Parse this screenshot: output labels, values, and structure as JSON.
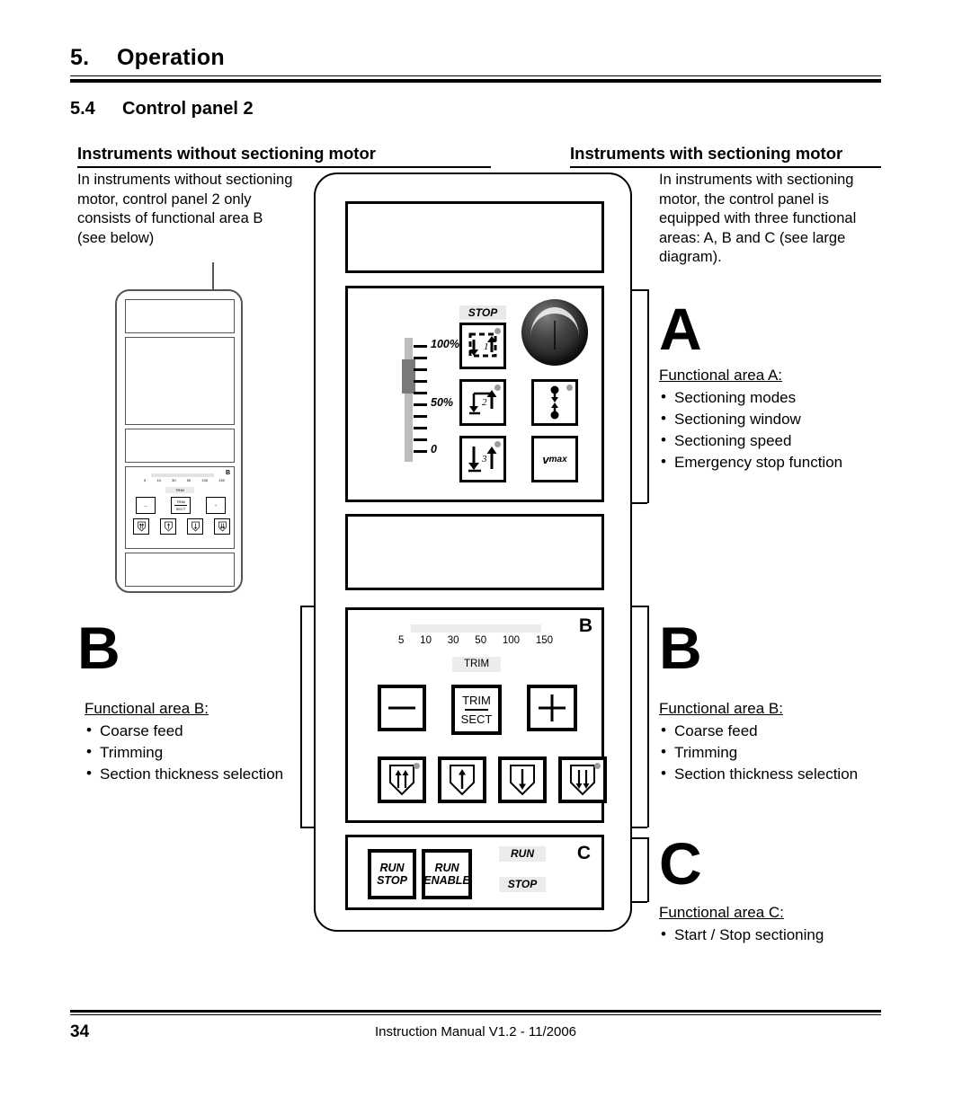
{
  "header": {
    "chapter_number": "5.",
    "chapter_title": "Operation",
    "section_number": "5.4",
    "section_title": "Control panel 2",
    "left_column_heading": "Instruments without sectioning motor",
    "right_column_heading": "Instruments with sectioning motor"
  },
  "left_column": {
    "intro": "In instruments without sectioning motor, control panel 2 only consists of functional area B (see below)",
    "big_letter": "B",
    "area_title": "Functional area B:",
    "bullets": [
      "Coarse feed",
      "Trimming",
      "Section thickness selection"
    ]
  },
  "right_column": {
    "intro": "In instruments with sectioning motor, the control panel is equipped with three functional areas: A, B and C (see large diagram).",
    "area_a": {
      "big_letter": "A",
      "title": "Functional area A:",
      "bullets": [
        "Sectioning modes",
        "Sectioning window",
        "Sectioning speed",
        "Emergency stop function"
      ]
    },
    "area_b": {
      "big_letter": "B",
      "title": "Functional area B:",
      "bullets": [
        "Coarse feed",
        "Trimming",
        "Section thickness selection"
      ]
    },
    "area_c": {
      "big_letter": "C",
      "title": "Functional area C:",
      "bullets": [
        "Start / Stop sectioning"
      ]
    }
  },
  "panel": {
    "area_a": {
      "label": "A",
      "stop_label": "STOP",
      "speed_scale": [
        "100%",
        "50%",
        "0"
      ],
      "mode_buttons": [
        "1",
        "2",
        "3"
      ],
      "vmax_label": "v",
      "vmax_sub": "max",
      "knob_name": "emergency-stop-knob"
    },
    "area_b": {
      "label": "B",
      "thickness_values": [
        "5",
        "10",
        "30",
        "50",
        "100",
        "150"
      ],
      "trim_indicator": "TRIM",
      "minus_label": "—",
      "plus_label": "+",
      "trim_sect_top": "TRIM",
      "trim_sect_bottom": "SECT",
      "feed_buttons": [
        "fast-up",
        "slow-up",
        "slow-down",
        "fast-down"
      ]
    },
    "area_c": {
      "label": "C",
      "run_stop_line1": "RUN",
      "run_stop_line2": "STOP",
      "run_enable_line1": "RUN",
      "run_enable_line2": "ENABLE",
      "lamp_run": "RUN",
      "lamp_stop": "STOP"
    }
  },
  "small_panel": {
    "label": "B",
    "thickness_values": [
      "5",
      "10",
      "30",
      "50",
      "100",
      "150"
    ],
    "trim_indicator": "TRIM",
    "minus_label": "—",
    "plus_label": "+",
    "trim_sect_top": "TRIM",
    "trim_sect_bottom": "SECT"
  },
  "footer": {
    "page_number": "34",
    "manual_text": "Instruction Manual V1.2 - 11/2006"
  },
  "colors": {
    "ink": "#000000",
    "panel_outline": "#555555",
    "lamp_grey": "#ececec",
    "led_grey": "#9c9c9c",
    "slider_track": "#bdbdbd",
    "slider_knob": "#7a7a7a"
  }
}
